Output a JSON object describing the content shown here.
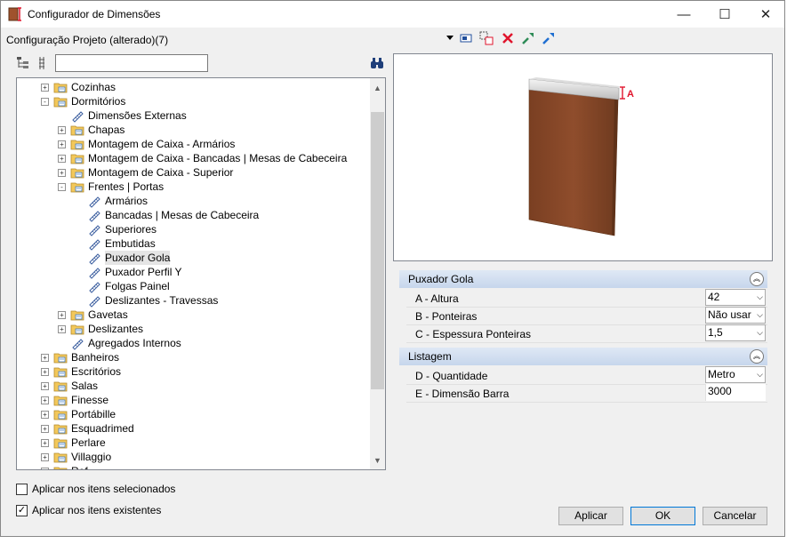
{
  "window": {
    "title": "Configurador de Dimensões",
    "minimize": "—",
    "maximize": "☐",
    "close": "✕"
  },
  "toolbar": {
    "config_label": "Configuração Projeto (alterado)(7)"
  },
  "tree": {
    "items": [
      {
        "label": "Cozinhas",
        "level": 1,
        "expander": "+",
        "icon": "folder-icon",
        "selected": false
      },
      {
        "label": "Dormitórios",
        "level": 1,
        "expander": "-",
        "icon": "folder-icon",
        "selected": false
      },
      {
        "label": "Dimensões Externas",
        "level": 2,
        "expander": "",
        "icon": "ruler-icon",
        "selected": false
      },
      {
        "label": "Chapas",
        "level": 2,
        "expander": "+",
        "icon": "folder-icon",
        "selected": false
      },
      {
        "label": "Montagem de Caixa - Armários",
        "level": 2,
        "expander": "+",
        "icon": "folder-icon",
        "selected": false
      },
      {
        "label": "Montagem de Caixa - Bancadas | Mesas de Cabeceira",
        "level": 2,
        "expander": "+",
        "icon": "folder-icon",
        "selected": false
      },
      {
        "label": "Montagem de Caixa - Superior",
        "level": 2,
        "expander": "+",
        "icon": "folder-icon",
        "selected": false
      },
      {
        "label": "Frentes | Portas",
        "level": 2,
        "expander": "-",
        "icon": "folder-icon",
        "selected": false
      },
      {
        "label": "Armários",
        "level": 3,
        "expander": "",
        "icon": "ruler-icon",
        "selected": false
      },
      {
        "label": "Bancadas | Mesas de Cabeceira",
        "level": 3,
        "expander": "",
        "icon": "ruler-icon",
        "selected": false
      },
      {
        "label": "Superiores",
        "level": 3,
        "expander": "",
        "icon": "ruler-icon",
        "selected": false
      },
      {
        "label": "Embutidas",
        "level": 3,
        "expander": "",
        "icon": "ruler-icon",
        "selected": false
      },
      {
        "label": "Puxador Gola",
        "level": 3,
        "expander": "",
        "icon": "ruler-icon",
        "selected": true
      },
      {
        "label": "Puxador Perfil Y",
        "level": 3,
        "expander": "",
        "icon": "ruler-icon",
        "selected": false
      },
      {
        "label": "Folgas Painel",
        "level": 3,
        "expander": "",
        "icon": "ruler-icon",
        "selected": false
      },
      {
        "label": "Deslizantes - Travessas",
        "level": 3,
        "expander": "",
        "icon": "ruler-icon",
        "selected": false
      },
      {
        "label": "Gavetas",
        "level": 2,
        "expander": "+",
        "icon": "folder-icon",
        "selected": false
      },
      {
        "label": "Deslizantes",
        "level": 2,
        "expander": "+",
        "icon": "folder-icon",
        "selected": false
      },
      {
        "label": "Agregados Internos",
        "level": 2,
        "expander": "",
        "icon": "ruler-icon",
        "selected": false
      },
      {
        "label": "Banheiros",
        "level": 1,
        "expander": "+",
        "icon": "folder-icon",
        "selected": false
      },
      {
        "label": "Escritórios",
        "level": 1,
        "expander": "+",
        "icon": "folder-icon",
        "selected": false
      },
      {
        "label": "Salas",
        "level": 1,
        "expander": "+",
        "icon": "folder-icon",
        "selected": false
      },
      {
        "label": "Finesse",
        "level": 1,
        "expander": "+",
        "icon": "folder-icon",
        "selected": false
      },
      {
        "label": "Portábille",
        "level": 1,
        "expander": "+",
        "icon": "folder-icon",
        "selected": false
      },
      {
        "label": "Esquadrimed",
        "level": 1,
        "expander": "+",
        "icon": "folder-icon",
        "selected": false
      },
      {
        "label": "Perlare",
        "level": 1,
        "expander": "+",
        "icon": "folder-icon",
        "selected": false
      },
      {
        "label": "Villaggio",
        "level": 1,
        "expander": "+",
        "icon": "folder-icon",
        "selected": false
      },
      {
        "label": "Ref...",
        "level": 1,
        "expander": "+",
        "icon": "folder-icon",
        "selected": false
      }
    ]
  },
  "preview": {
    "dimension_marker": "A"
  },
  "properties": {
    "groups": [
      {
        "title": "Puxador Gola",
        "rows": [
          {
            "label": "A - Altura",
            "value": "42",
            "dropdown": true
          },
          {
            "label": "B - Ponteiras",
            "value": "Não usar",
            "dropdown": true
          },
          {
            "label": "C - Espessura Ponteiras",
            "value": "1,5",
            "dropdown": true
          }
        ]
      },
      {
        "title": "Listagem",
        "rows": [
          {
            "label": "D - Quantidade",
            "value": "Metro",
            "dropdown": true
          },
          {
            "label": "E - Dimensão Barra",
            "value": "3000",
            "dropdown": false
          }
        ]
      }
    ]
  },
  "options": {
    "apply_selected_label": "Aplicar nos itens selecionados",
    "apply_selected_checked": false,
    "apply_existing_label": "Aplicar nos itens existentes",
    "apply_existing_checked": true
  },
  "buttons": {
    "apply": "Aplicar",
    "ok": "OK",
    "cancel": "Cancelar"
  },
  "colors": {
    "wood": "#8b4a2b",
    "accent_red": "#e0142c",
    "group_header": "#c6d6ec"
  }
}
